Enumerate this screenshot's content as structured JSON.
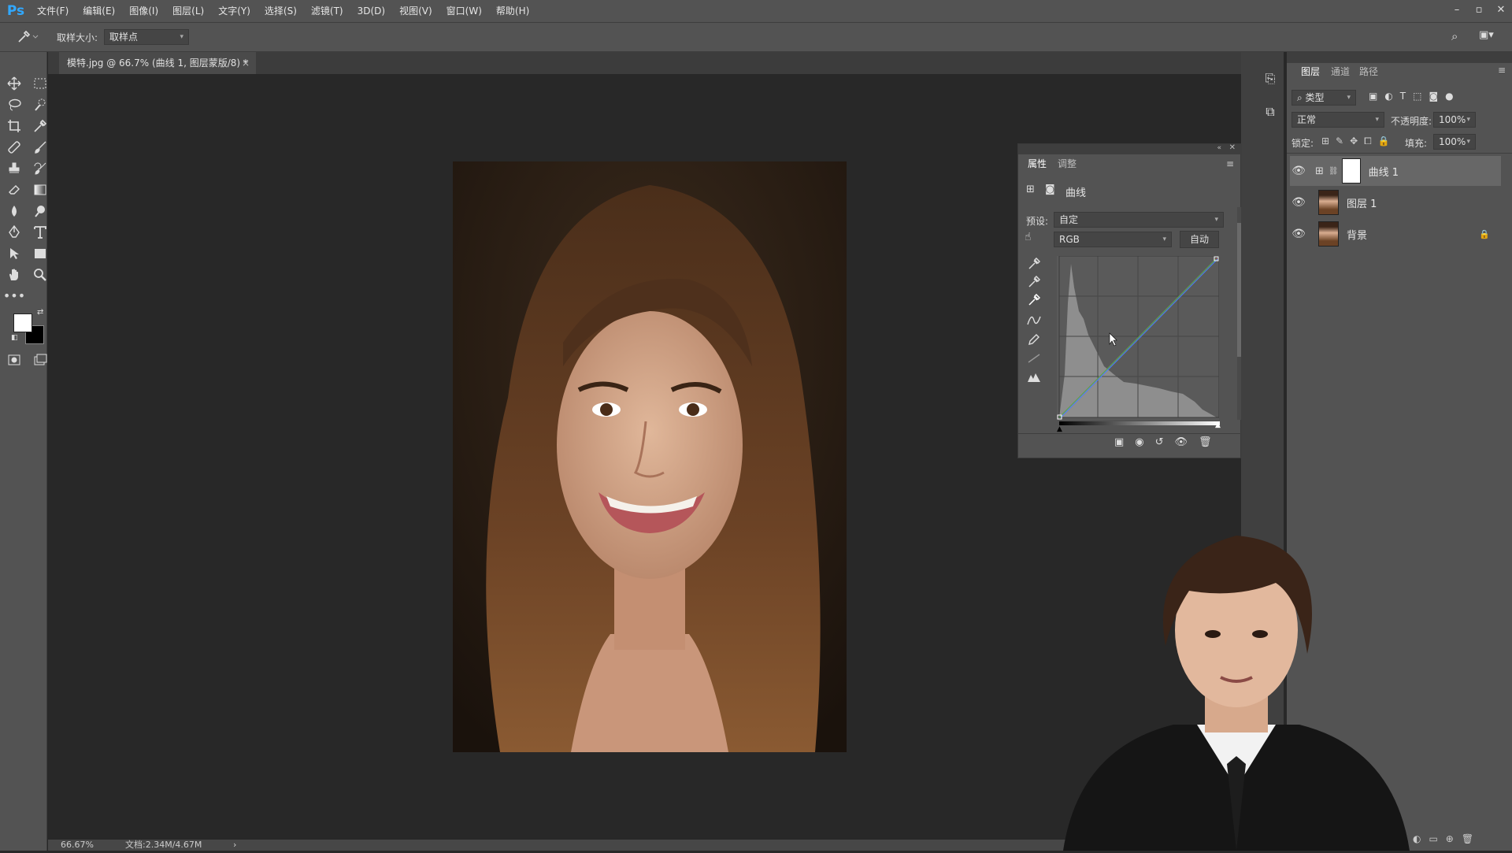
{
  "app": {
    "logo": "Ps"
  },
  "menu": [
    "文件(F)",
    "编辑(E)",
    "图像(I)",
    "图层(L)",
    "文字(Y)",
    "选择(S)",
    "滤镜(T)",
    "3D(D)",
    "视图(V)",
    "窗口(W)",
    "帮助(H)"
  ],
  "window_controls": {
    "minimize": "–",
    "restore": "▫",
    "close": "✕"
  },
  "options": {
    "sample_size_label": "取样大小:",
    "sample_size_value": "取样点",
    "tool_icon": "eyedropper-icon"
  },
  "document": {
    "tab_title": "模特.jpg @ 66.7% (曲线 1, 图层蒙版/8) *",
    "close": "×"
  },
  "status": {
    "zoom": "66.67%",
    "doc_info": "文档:2.34M/4.67M",
    "arrow": "›"
  },
  "properties": {
    "tabs": [
      "属性",
      "调整"
    ],
    "adjustment_name": "曲线",
    "preset_label": "预设:",
    "preset_value": "自定",
    "channel_value": "RGB",
    "auto_button": "自动"
  },
  "layers_panel": {
    "tabs": [
      "图层",
      "通道",
      "路径"
    ],
    "filter_kind": "类型",
    "blend_mode": "正常",
    "opacity_label": "不透明度:",
    "opacity_value": "100%",
    "lock_label": "锁定:",
    "fill_label": "填充:",
    "fill_value": "100%",
    "layers": [
      {
        "name": "曲线 1",
        "type": "adjustment",
        "selected": true
      },
      {
        "name": "图层 1",
        "type": "image",
        "selected": false
      },
      {
        "name": "背景",
        "type": "image",
        "selected": false,
        "locked": true
      }
    ]
  },
  "colors": {
    "accent": "#31a8ff",
    "chrome": "#535353",
    "canvas": "#282828",
    "selected_layer": "#676767"
  }
}
